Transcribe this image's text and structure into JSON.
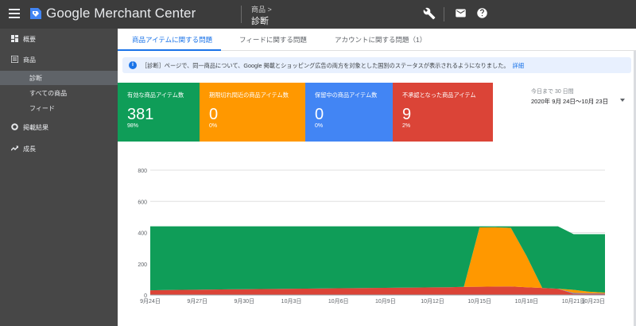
{
  "header": {
    "app_name": "Google Merchant Center",
    "breadcrumb_parent": "商品 >",
    "breadcrumb_current": "診断"
  },
  "sidebar": {
    "items": [
      {
        "label": "概要",
        "icon": "dashboard-icon"
      },
      {
        "label": "商品",
        "icon": "list-icon"
      },
      {
        "label": "診断",
        "sub": true,
        "active": true
      },
      {
        "label": "すべての商品",
        "sub": true
      },
      {
        "label": "フィード",
        "sub": true
      },
      {
        "label": "掲載結果",
        "icon": "donut-icon"
      },
      {
        "label": "成長",
        "icon": "trending-up-icon"
      }
    ]
  },
  "tabs": [
    {
      "label": "商品アイテムに関する問題",
      "active": true
    },
    {
      "label": "フィードに関する問題"
    },
    {
      "label": "アカウントに関する問題（1）"
    }
  ],
  "info_banner": {
    "text": "［診断］ページで、同一商品について、Google 掲載とショッピング広告の両方を対象とした国別のステータスが表示されるようになりました。",
    "link": "詳細"
  },
  "cards": [
    {
      "title": "有効な商品アイテム数",
      "value": "381",
      "percent": "98%",
      "color": "#0f9d58"
    },
    {
      "title": "期限切れ間近の商品アイテム数",
      "value": "0",
      "percent": "0%",
      "color": "#ff9800"
    },
    {
      "title": "保留中の商品アイテム数",
      "value": "0",
      "percent": "0%",
      "color": "#4285f4"
    },
    {
      "title": "不承認となった商品アイテム",
      "value": "9",
      "percent": "2%",
      "color": "#db4437"
    }
  ],
  "date_range": {
    "caption": "今日まで 30 日間",
    "value": "2020年 9月 24日〜10月 23日"
  },
  "chart_data": {
    "type": "area",
    "stacked": true,
    "ylim": [
      0,
      800
    ],
    "yticks": [
      0,
      200,
      400,
      600,
      800
    ],
    "xtick_labels": [
      "9月24日",
      "9月27日",
      "9月30日",
      "10月3日",
      "10月6日",
      "10月9日",
      "10月12日",
      "10月15日",
      "10月18日",
      "10月21日",
      "10月23日"
    ],
    "xtick_days": [
      0,
      3,
      6,
      9,
      12,
      15,
      18,
      21,
      24,
      27,
      29
    ],
    "x_days": [
      0,
      1,
      2,
      3,
      4,
      5,
      6,
      7,
      8,
      9,
      10,
      11,
      12,
      13,
      14,
      15,
      16,
      17,
      18,
      19,
      20,
      21,
      22,
      23,
      24,
      25,
      26,
      27,
      28,
      29
    ],
    "series": [
      {
        "color": "#db4437",
        "values": [
          30,
          32,
          33,
          34,
          35,
          36,
          37,
          38,
          39,
          40,
          41,
          42,
          43,
          44,
          45,
          46,
          47,
          48,
          49,
          50,
          52,
          53,
          54,
          55,
          50,
          45,
          40,
          8,
          8,
          8
        ]
      },
      {
        "color": "#4285f4",
        "values": [
          0,
          0,
          0,
          0,
          0,
          0,
          0,
          0,
          0,
          0,
          0,
          0,
          0,
          0,
          0,
          0,
          0,
          0,
          0,
          0,
          0,
          0,
          0,
          0,
          0,
          0,
          0,
          5,
          3,
          2
        ]
      },
      {
        "color": "#ff9800",
        "values": [
          0,
          0,
          0,
          0,
          0,
          0,
          0,
          0,
          0,
          0,
          0,
          0,
          0,
          0,
          0,
          0,
          0,
          0,
          0,
          0,
          0,
          380,
          380,
          375,
          200,
          0,
          0,
          20,
          10,
          5
        ]
      },
      {
        "color": "#0f9d58",
        "values": [
          410,
          408,
          407,
          406,
          405,
          404,
          403,
          402,
          401,
          400,
          399,
          398,
          397,
          396,
          395,
          394,
          393,
          392,
          391,
          390,
          388,
          7,
          6,
          10,
          190,
          395,
          400,
          357,
          369,
          375
        ]
      }
    ]
  }
}
